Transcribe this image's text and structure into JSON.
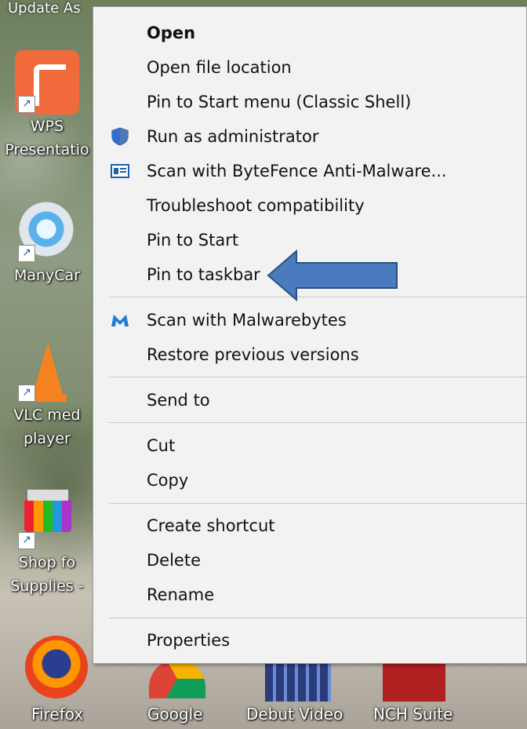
{
  "desktop": {
    "top_cut_label": "Update As",
    "icons": [
      {
        "label_lines": [
          "WPS",
          "Presentatio"
        ]
      },
      {
        "label_lines": [
          "ManyCar"
        ]
      },
      {
        "label_lines": [
          "VLC med",
          "player"
        ]
      },
      {
        "label_lines": [
          "Shop fo",
          "Supplies -"
        ]
      }
    ],
    "bottom_labels": [
      "Firefox",
      "Google",
      "Debut Video",
      "NCH Suite"
    ]
  },
  "context_menu": {
    "items": [
      {
        "label": "Open",
        "bold": true
      },
      {
        "label": "Open file location"
      },
      {
        "label": "Pin to Start menu (Classic Shell)"
      },
      {
        "label": "Run as administrator",
        "icon": "uac-shield-icon"
      },
      {
        "label": "Scan with ByteFence Anti-Malware...",
        "icon": "bytefence-icon"
      },
      {
        "label": "Troubleshoot compatibility"
      },
      {
        "label": "Pin to Start"
      },
      {
        "label": "Pin to taskbar"
      },
      {
        "label": "Scan with Malwarebytes",
        "icon": "malwarebytes-icon"
      },
      {
        "label": "Restore previous versions"
      },
      {
        "label": "Send to"
      },
      {
        "label": "Cut"
      },
      {
        "label": "Copy"
      },
      {
        "label": "Create shortcut"
      },
      {
        "label": "Delete"
      },
      {
        "label": "Rename"
      },
      {
        "label": "Properties"
      }
    ]
  },
  "annotation": {
    "arrow_color": "#4a7bbf",
    "points_to": "Pin to taskbar"
  }
}
